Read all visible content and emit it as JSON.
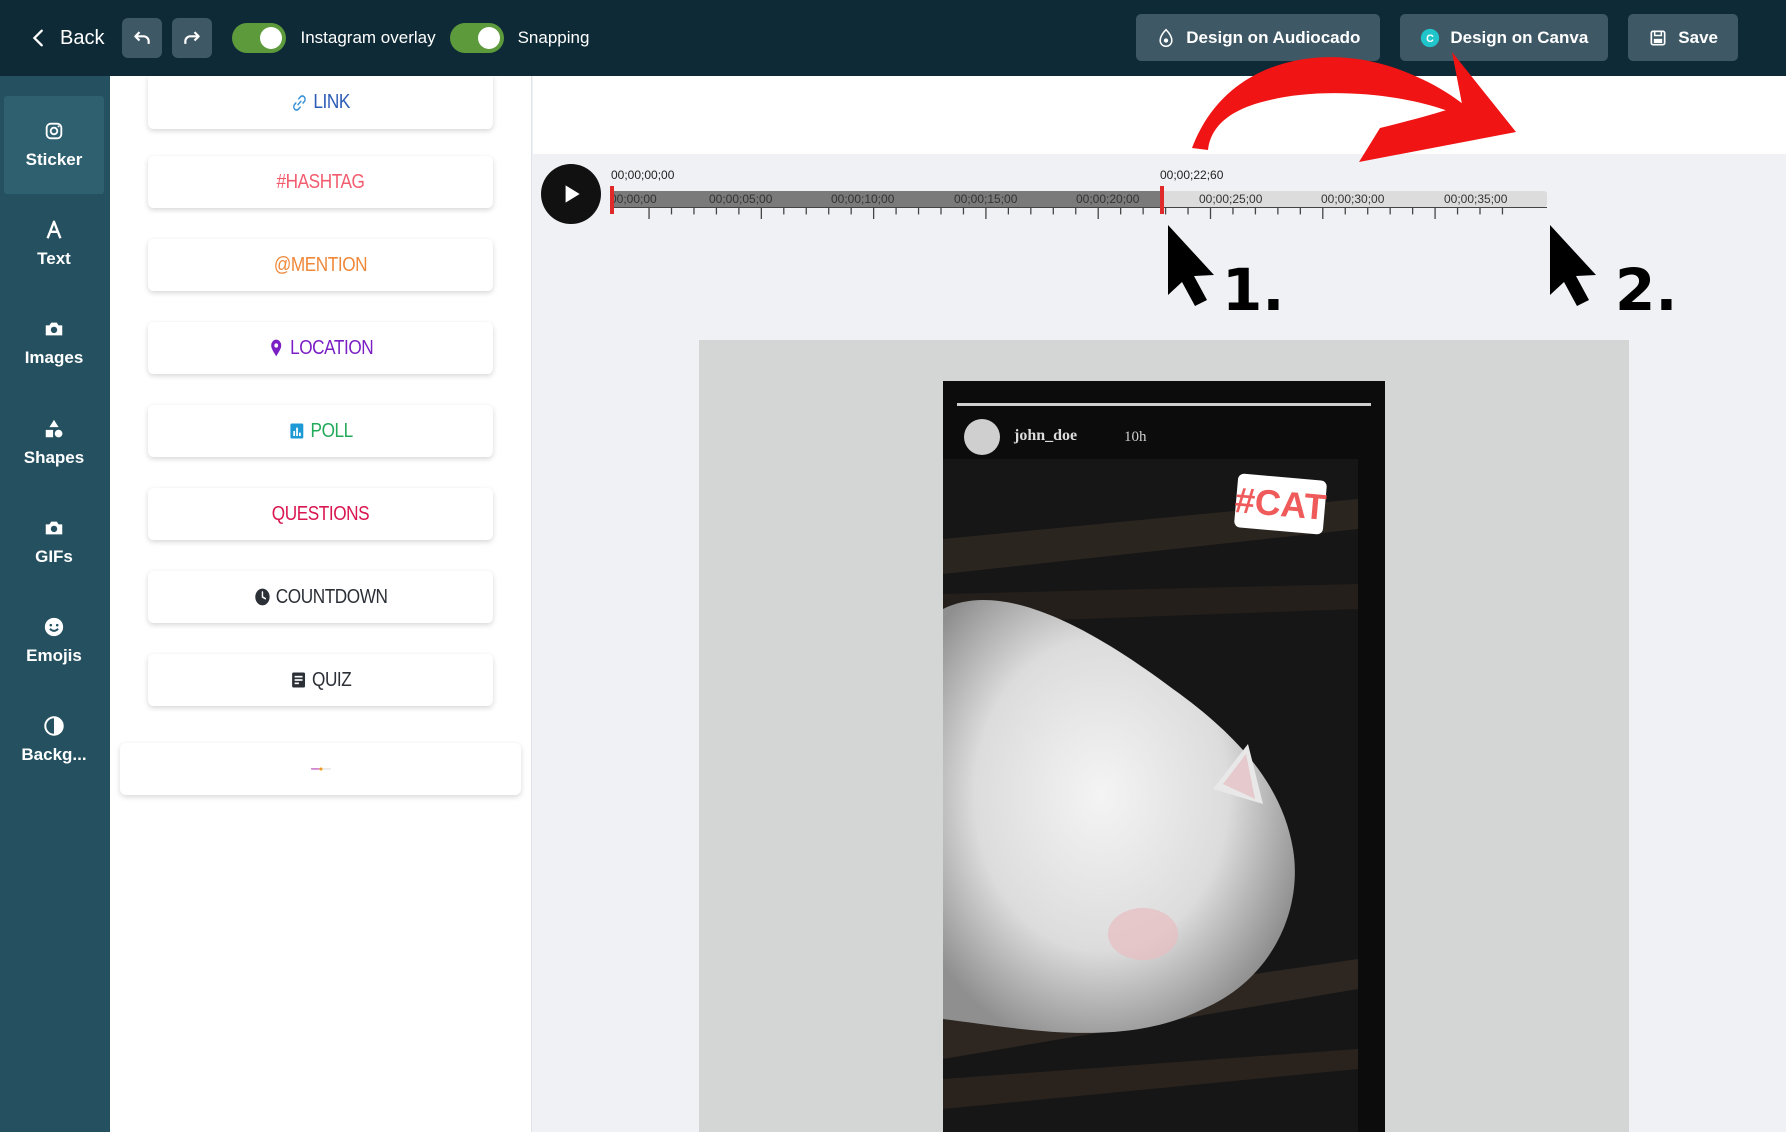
{
  "topbar": {
    "back_label": "Back",
    "instagram_overlay_label": "Instagram overlay",
    "snapping_label": "Snapping",
    "instagram_overlay_on": true,
    "snapping_on": true,
    "audiocado_label": "Design on Audiocado",
    "canva_label": "Design on Canva",
    "save_label": "Save",
    "button_bg": "#3e5865",
    "bar_bg": "#0e2a36"
  },
  "sidebar": {
    "items": [
      {
        "label": "Sticker",
        "icon": "instagram-icon",
        "active": true
      },
      {
        "label": "Text",
        "icon": "text-icon"
      },
      {
        "label": "Images",
        "icon": "camera-icon"
      },
      {
        "label": "Shapes",
        "icon": "shapes-icon"
      },
      {
        "label": "GIFs",
        "icon": "camera-icon"
      },
      {
        "label": "Emojis",
        "icon": "smiley-icon"
      },
      {
        "label": "Backg...",
        "icon": "contrast-icon"
      }
    ]
  },
  "stickers": {
    "link": "LINK",
    "hashtag": "#HASHTAG",
    "mention": "@MENTION",
    "location": "LOCATION",
    "poll": "POLL",
    "questions": "QUESTIONS",
    "countdown": "COUNTDOWN",
    "quiz": "QUIZ",
    "slider_value": 0.5,
    "colors": {
      "link": "#2b5bb5",
      "hashtag": "#f25c6e",
      "mention": "#f0883a",
      "location": "#7b1fc4",
      "poll": "#22a95a",
      "questions": "#d91650",
      "countdown": "#2b2f36",
      "quiz": "#2b2f36"
    }
  },
  "timeline": {
    "start": "00;00;00;00",
    "playhead": "00;00;22;60",
    "ticks": [
      "00;00;00",
      "00;00;05;00",
      "00;00;10;00",
      "00;00;15;00",
      "00;00;20;00",
      "00;00;25;00",
      "00;00;30;00",
      "00;00;35;00"
    ]
  },
  "story": {
    "username": "john_doe",
    "time": "10h",
    "sticker_text": "#CAT"
  },
  "annotations": {
    "label1": "1.",
    "label2": "2.",
    "arrow_color": "#f01414"
  }
}
